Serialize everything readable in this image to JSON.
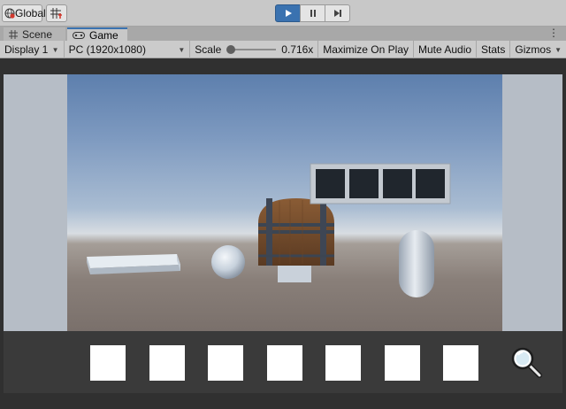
{
  "toolbar": {
    "global_label": "Global",
    "global_icon": "global-icon",
    "grid_icon": "grid-snap-icon",
    "play_icon": "play-icon",
    "pause_icon": "pause-icon",
    "step_icon": "step-icon",
    "play_active": true
  },
  "tabs": [
    {
      "label": "Scene",
      "icon": "hash-icon",
      "active": false
    },
    {
      "label": "Game",
      "icon": "gamepad-icon",
      "active": true
    }
  ],
  "game_bar": {
    "display": "Display 1",
    "resolution": "PC (1920x1080)",
    "scale_label": "Scale",
    "scale_value": "0.716x",
    "maximize_on_play": "Maximize On Play",
    "mute_audio": "Mute Audio",
    "stats": "Stats",
    "gizmos": "Gizmos"
  },
  "scene": {
    "objects": [
      "cube",
      "sphere",
      "treasure-chest",
      "capsule",
      "slot-frame"
    ],
    "frame_slots": 4
  },
  "hud": {
    "inventory_slots": 7,
    "magnifier_icon": "magnifier-icon"
  },
  "colors": {
    "accent": "#3a72b0",
    "toolbar_bg": "#c8c8c8",
    "hud_bg": "#3a3a3a"
  }
}
